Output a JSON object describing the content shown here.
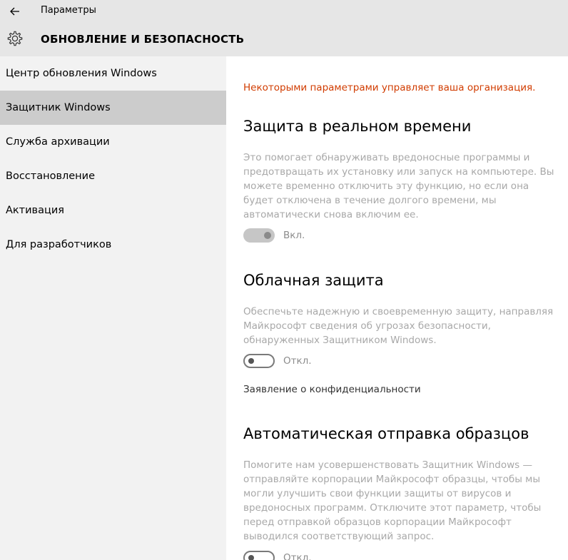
{
  "window": {
    "app_title": "Параметры",
    "back_icon": "arrow-left-icon"
  },
  "header": {
    "icon": "gear-icon",
    "title": "ОБНОВЛЕНИЕ И БЕЗОПАСНОСТЬ"
  },
  "sidebar": {
    "items": [
      {
        "label": "Центр обновления Windows",
        "selected": false
      },
      {
        "label": "Защитник Windows",
        "selected": true
      },
      {
        "label": "Служба архивации",
        "selected": false
      },
      {
        "label": "Восстановление",
        "selected": false
      },
      {
        "label": "Активация",
        "selected": false
      },
      {
        "label": "Для разработчиков",
        "selected": false
      }
    ]
  },
  "main": {
    "org_notice": "Некоторыми параметрами управляет ваша организация.",
    "realtime": {
      "title": "Защита в реальном времени",
      "description": "Это помогает обнаруживать вредоносные программы и предотвращать их установку или запуск на компьютере. Вы можете временно отключить эту функцию, но если она будет отключена в течение долгого времени, мы автоматически снова включим ее.",
      "toggle_state": "Вкл.",
      "enabled": true,
      "managed": true
    },
    "cloud": {
      "title": "Облачная защита",
      "description": "Обеспечьте надежную и своевременную защиту, направляя Майкрософт сведения об угрозах безопасности, обнаруженных Защитником Windows.",
      "toggle_state": "Откл.",
      "enabled": false
    },
    "privacy_link": "Заявление о конфиденциальности",
    "samples": {
      "title": "Автоматическая отправка образцов",
      "description": "Помогите нам усовершенствовать Защитник Windows — отправляйте корпорации Майкрософт образцы, чтобы мы могли улучшить свои функции защиты от вирусов и вредоносных программ. Отключите этот параметр, чтобы перед отправкой образцов корпорации Майкрософт выводился соответствующий запрос.",
      "toggle_state": "Откл.",
      "enabled": false
    }
  },
  "colors": {
    "chrome_bg": "#e6e6e6",
    "sidebar_bg": "#f2f2f2",
    "selected_bg": "#cccccc",
    "notice": "#d13c00",
    "disabled_text": "#a8a8a8"
  }
}
